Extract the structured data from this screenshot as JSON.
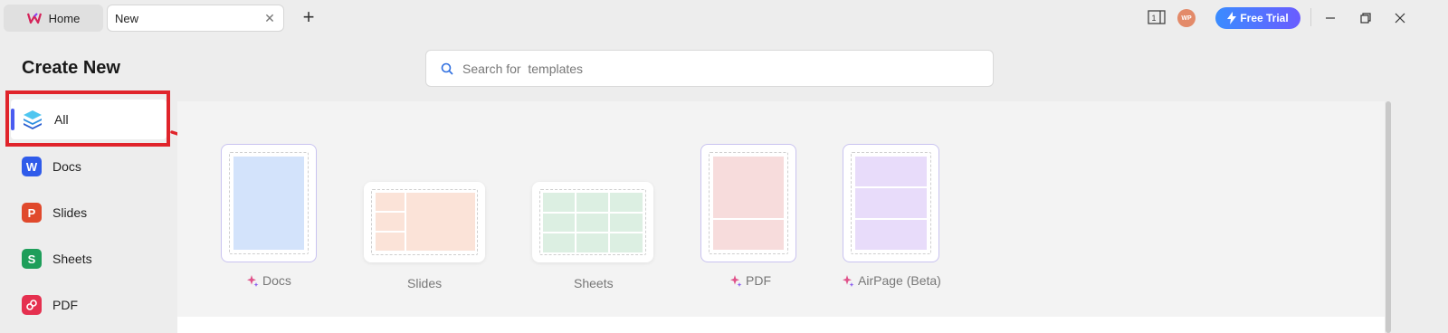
{
  "tabs": {
    "home_label": "Home",
    "new_label": "New"
  },
  "titlebar": {
    "avatar_initials": "WP",
    "sidebar_toggle_number": "1",
    "free_trial_label": "Free Trial"
  },
  "page": {
    "title": "Create New"
  },
  "search": {
    "placeholder": "Search for  templates"
  },
  "sidebar": {
    "items": [
      {
        "label": "All",
        "icon": "layers-icon",
        "active": true
      },
      {
        "label": "Docs",
        "icon_letter": "W",
        "color": "#2f5bea"
      },
      {
        "label": "Slides",
        "icon_letter": "P",
        "color": "#e0492c"
      },
      {
        "label": "Sheets",
        "icon_letter": "S",
        "color": "#1e9e5a"
      },
      {
        "label": "PDF",
        "icon": "pdf-icon",
        "color": "#e5304f"
      }
    ]
  },
  "templates": [
    {
      "label": "Docs",
      "ai": true,
      "color": "#d3e3fb"
    },
    {
      "label": "Slides",
      "ai": false,
      "color": "#fbe3d8"
    },
    {
      "label": "Sheets",
      "ai": false,
      "color": "#dcefe2"
    },
    {
      "label": "PDF",
      "ai": true,
      "color": "#f7dcdc"
    },
    {
      "label": "AirPage (Beta)",
      "ai": true,
      "color": "#e8dcfa"
    }
  ],
  "colors": {
    "accent": "#4a5cf0",
    "highlight": "#e0242b",
    "free_trial": "#3a8cff"
  }
}
